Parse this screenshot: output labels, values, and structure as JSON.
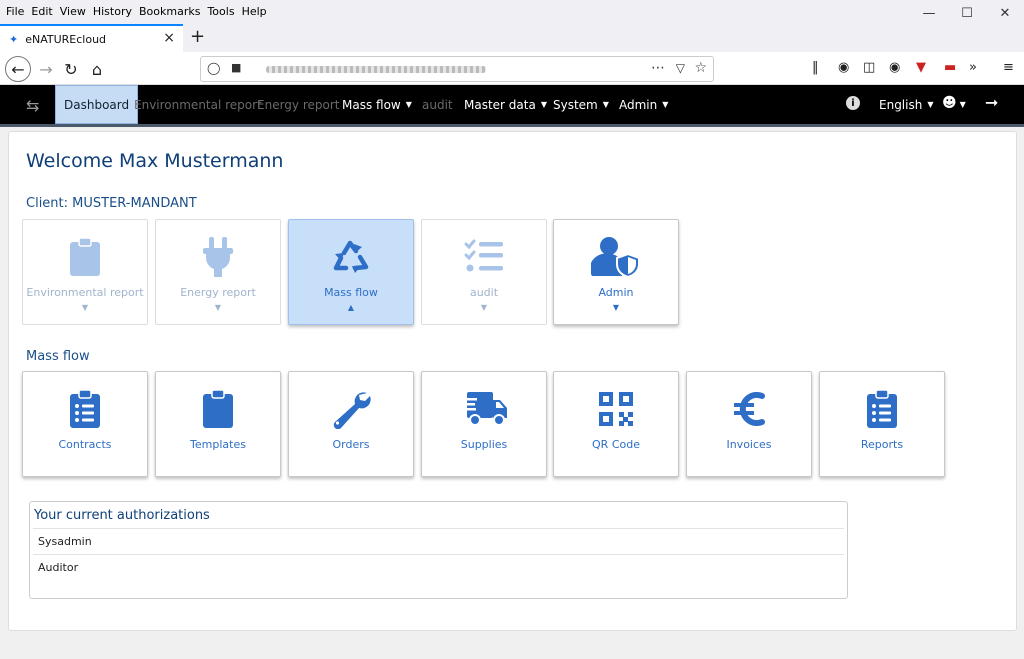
{
  "browser": {
    "menu": [
      "File",
      "Edit",
      "View",
      "History",
      "Bookmarks",
      "Tools",
      "Help"
    ],
    "tab_title": "eNATUREcloud",
    "window_controls": [
      "—",
      "☐",
      "✕"
    ]
  },
  "appnav": {
    "items": [
      {
        "label": "Dashboard",
        "state": "active",
        "caret": false
      },
      {
        "label": "Environmental report",
        "state": "disabled",
        "caret": false
      },
      {
        "label": "Energy report",
        "state": "disabled",
        "caret": false
      },
      {
        "label": "Mass flow",
        "state": "normal",
        "caret": true
      },
      {
        "label": "audit",
        "state": "disabled",
        "caret": false
      },
      {
        "label": "Master data",
        "state": "normal",
        "caret": true
      },
      {
        "label": "System",
        "state": "normal",
        "caret": true
      },
      {
        "label": "Admin",
        "state": "normal",
        "caret": true
      }
    ],
    "language": "English"
  },
  "page": {
    "welcome": "Welcome Max Mustermann",
    "client_label": "Client: MUSTER-MANDANT",
    "client_tiles": [
      {
        "label": "Environmental report",
        "icon": "clipboard-icon",
        "state": "disabled",
        "caret": "down"
      },
      {
        "label": "Energy report",
        "icon": "plug-icon",
        "state": "disabled",
        "caret": "down"
      },
      {
        "label": "Mass flow",
        "icon": "recycle-icon",
        "state": "selected",
        "caret": "up"
      },
      {
        "label": "audit",
        "icon": "checklist-icon",
        "state": "disabled",
        "caret": "down"
      },
      {
        "label": "Admin",
        "icon": "user-shield-icon",
        "state": "normal",
        "caret": "down"
      }
    ],
    "massflow_label": "Mass flow",
    "massflow_tiles": [
      {
        "label": "Contracts",
        "icon": "clipboard-list-icon"
      },
      {
        "label": "Templates",
        "icon": "clipboard-icon"
      },
      {
        "label": "Orders",
        "icon": "wrench-icon"
      },
      {
        "label": "Supplies",
        "icon": "truck-icon"
      },
      {
        "label": "QR Code",
        "icon": "qrcode-icon"
      },
      {
        "label": "Invoices",
        "icon": "euro-icon"
      },
      {
        "label": "Reports",
        "icon": "clipboard-list-icon"
      }
    ],
    "auth_title": "Your current authorizations",
    "authorizations": [
      "Sysadmin",
      "Auditor"
    ]
  },
  "colors": {
    "accent": "#3a78d6",
    "accent_disabled": "#a8c4e8",
    "heading": "#0f3f78",
    "nav_active_bg": "#c6dcf5"
  }
}
